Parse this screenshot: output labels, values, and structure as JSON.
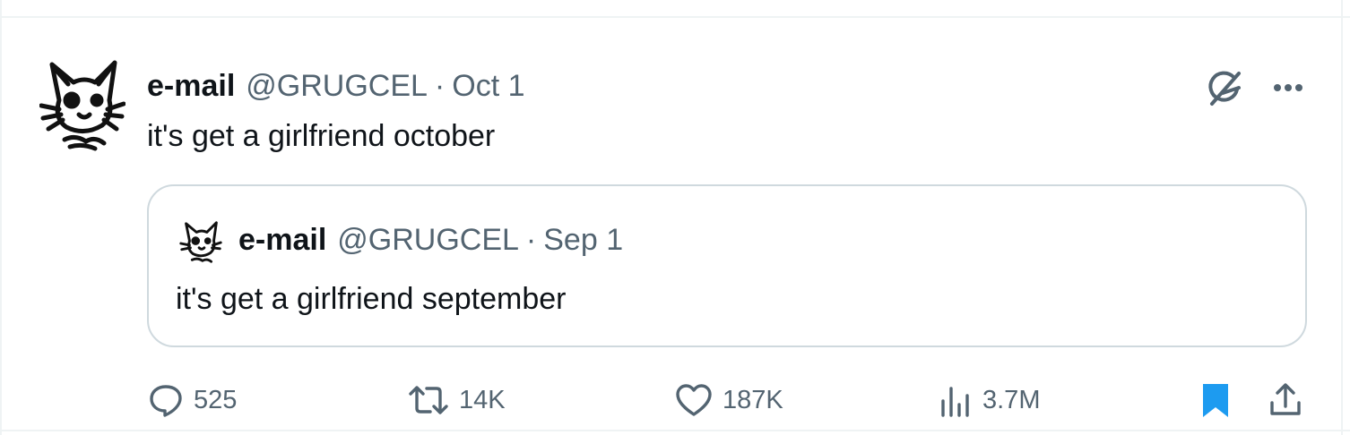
{
  "tweet": {
    "author": {
      "display_name": "e-mail",
      "handle": "@GRUGCEL"
    },
    "separator": "·",
    "date": "Oct 1",
    "text": "it's get a girlfriend october",
    "quoted": {
      "author": {
        "display_name": "e-mail",
        "handle": "@GRUGCEL"
      },
      "separator": "·",
      "date": "Sep 1",
      "text": "it's get a girlfriend september"
    },
    "metrics": {
      "replies": "525",
      "retweets": "14K",
      "likes": "187K",
      "views": "3.7M"
    },
    "icons": {
      "grok": "grok-icon",
      "more": "more-icon",
      "reply": "reply-icon",
      "retweet": "retweet-icon",
      "like": "heart-icon",
      "views": "views-icon",
      "bookmark": "bookmark-icon",
      "share": "share-icon"
    },
    "colors": {
      "text_primary": "#0f1419",
      "text_secondary": "#536471",
      "bookmark_active": "#1d9bf0",
      "border": "#cfd9de"
    }
  }
}
